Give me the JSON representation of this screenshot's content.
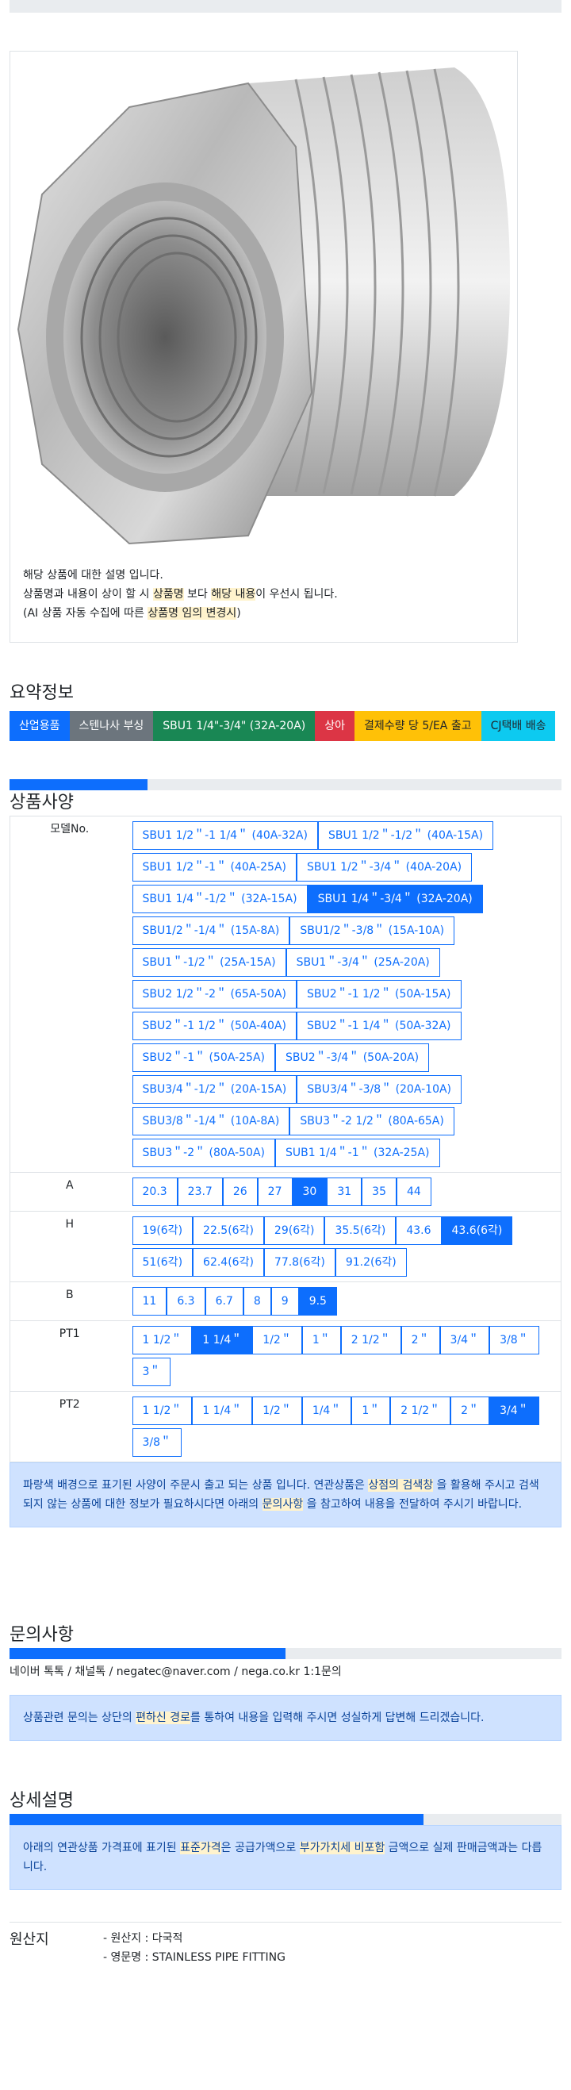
{
  "image_note": {
    "line1": "해당 상품에 대한 설명 입니다.",
    "line2_a": "상품명과 내용이 상이 할 시 ",
    "line2_hl1": "상품명",
    "line2_b": " 보다 ",
    "line2_hl2": "해당 내용",
    "line2_c": "이 우선시 됩니다.",
    "line3_a": "(AI 상품 자동 수집에 따른 ",
    "line3_hl": "상품명 임의 변경시",
    "line3_b": ")"
  },
  "summary": {
    "title": "요약정보",
    "badges": [
      {
        "label": "산업용품",
        "color": "#0d6efd"
      },
      {
        "label": "스텐나사 부싱",
        "color": "#6c757d"
      },
      {
        "label": "SBU1 1/4\"-3/4\" (32A-20A)",
        "color": "#198754"
      },
      {
        "label": "상아",
        "color": "#dc3545"
      },
      {
        "label": "결제수량 당 5/EA 출고",
        "color": "#ffc107",
        "text": "#212529"
      },
      {
        "label": "CJ택배 배송",
        "color": "#0dcaf0",
        "text": "#212529"
      }
    ]
  },
  "specs": {
    "title": "상품사양",
    "progress": 0.25,
    "rows": [
      {
        "label": "모델No.",
        "options": [
          "SBU1 1/2＂-1 1/4＂ (40A-32A)",
          "SBU1 1/2＂-1/2＂ (40A-15A)",
          "SBU1 1/2＂-1＂ (40A-25A)",
          "SBU1 1/2＂-3/4＂ (40A-20A)",
          "SBU1 1/4＂-1/2＂ (32A-15A)",
          "SBU1 1/4＂-3/4＂ (32A-20A)",
          "SBU1/2＂-1/4＂ (15A-8A)",
          "SBU1/2＂-3/8＂ (15A-10A)",
          "SBU1＂-1/2＂ (25A-15A)",
          "SBU1＂-3/4＂ (25A-20A)",
          "SBU2 1/2＂-2＂ (65A-50A)",
          "SBU2＂-1 1/2＂ (50A-15A)",
          "SBU2＂-1 1/2＂ (50A-40A)",
          "SBU2＂-1 1/4＂ (50A-32A)",
          "SBU2＂-1＂ (50A-25A)",
          "SBU2＂-3/4＂ (50A-20A)",
          "SBU3/4＂-1/2＂ (20A-15A)",
          "SBU3/4＂-3/8＂ (20A-10A)",
          "SBU3/8＂-1/4＂ (10A-8A)",
          "SBU3＂-2 1/2＂ (80A-65A)",
          "SBU3＂-2＂ (80A-50A)",
          "SUB1 1/4＂-1＂ (32A-25A)"
        ],
        "selected": 5
      },
      {
        "label": "A",
        "options": [
          "20.3",
          "23.7",
          "26",
          "27",
          "30",
          "31",
          "35",
          "44"
        ],
        "selected": 4
      },
      {
        "label": "H",
        "options": [
          "19(6각)",
          "22.5(6각)",
          "29(6각)",
          "35.5(6각)",
          "43.6",
          "43.6(6각)",
          "51(6각)",
          "62.4(6각)",
          "77.8(6각)",
          "91.2(6각)"
        ],
        "selected": 5
      },
      {
        "label": "B",
        "options": [
          "11",
          "6.3",
          "6.7",
          "8",
          "9",
          "9.5"
        ],
        "selected": 5
      },
      {
        "label": "PT1",
        "options": [
          "1 1/2＂",
          "1 1/4＂",
          "1/2＂",
          "1＂",
          "2 1/2＂",
          "2＂",
          "3/4＂",
          "3/8＂",
          "3＂"
        ],
        "selected": 1
      },
      {
        "label": "PT2",
        "options": [
          "1 1/2＂",
          "1 1/4＂",
          "1/2＂",
          "1/4＂",
          "1＂",
          "2 1/2＂",
          "2＂",
          "3/4＂",
          "3/8＂"
        ],
        "selected": 7
      }
    ],
    "notice": {
      "a": "파랑색 배경으로 표기된 사양이 주문시 출고 되는 상품 입니다. 연관상품은 ",
      "hl1": "상점의 검색창",
      "b": " 을 활용해 주시고 검색되지 않는 상품에 대한 정보가 필요하시다면 아래의 ",
      "hl2": "문의사항",
      "c": " 을 참고하여 내용을 전달하여 주시기 바랍니다."
    }
  },
  "inquiry": {
    "title": "문의사항",
    "progress": 0.5,
    "contacts": [
      "네이버 톡톡",
      "채널톡",
      "negatec@naver.com",
      "nega.co.kr 1:1문의"
    ],
    "notice": {
      "a": "상품관련 문의는 상단의 ",
      "hl": "편하신 경로",
      "b": "를 통하여 내용을 입력해 주시면 성실하게 답변해 드리겠습니다."
    }
  },
  "detail": {
    "title": "상세설명",
    "progress": 0.75,
    "notice": {
      "a": "아래의 연관상품 가격표에 표기된 ",
      "hl1": "표준가격",
      "b": "은 공급가액으로 ",
      "hl2": "부가가치세 비포함",
      "c": " 금액으로 실제 판매금액과는 다릅니다."
    }
  },
  "origin": {
    "label": "원산지",
    "lines": [
      "- 원산지 : 다국적",
      "- 영문명 : STAINLESS PIPE FITTING"
    ]
  }
}
